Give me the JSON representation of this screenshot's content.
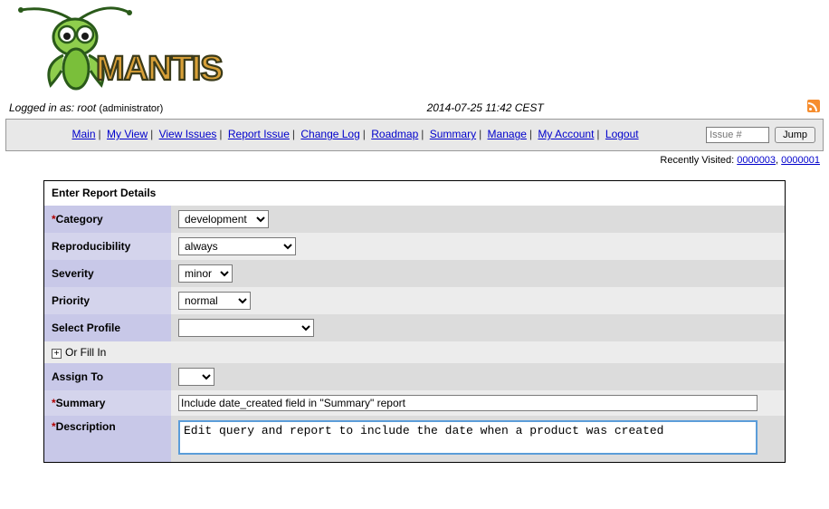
{
  "header": {
    "logged_in_prefix": "Logged in as: ",
    "username": "root",
    "role": "(administrator)",
    "timestamp": "2014-07-25 11:42 CEST"
  },
  "menu": {
    "main": "Main",
    "my_view": "My View",
    "view_issues": "View Issues",
    "report_issue": "Report Issue",
    "change_log": "Change Log",
    "roadmap": "Roadmap",
    "summary": "Summary",
    "manage": "Manage",
    "my_account": "My Account",
    "logout": "Logout"
  },
  "jump": {
    "placeholder": "Issue #",
    "button": "Jump"
  },
  "recent": {
    "label": "Recently Visited: ",
    "items": [
      "0000003",
      "0000001"
    ]
  },
  "form": {
    "title": "Enter Report Details",
    "labels": {
      "category": "Category",
      "reproducibility": "Reproducibility",
      "severity": "Severity",
      "priority": "Priority",
      "select_profile": "Select Profile",
      "or_fill_in": "Or Fill In",
      "assign_to": "Assign To",
      "summary": "Summary",
      "description": "Description"
    },
    "values": {
      "category": "development",
      "reproducibility": "always",
      "severity": "minor",
      "priority": "normal",
      "select_profile": "",
      "assign_to": "",
      "summary": "Include date_created field in \"Summary\" report",
      "description": "Edit query and report to include the date when a product was created"
    }
  }
}
